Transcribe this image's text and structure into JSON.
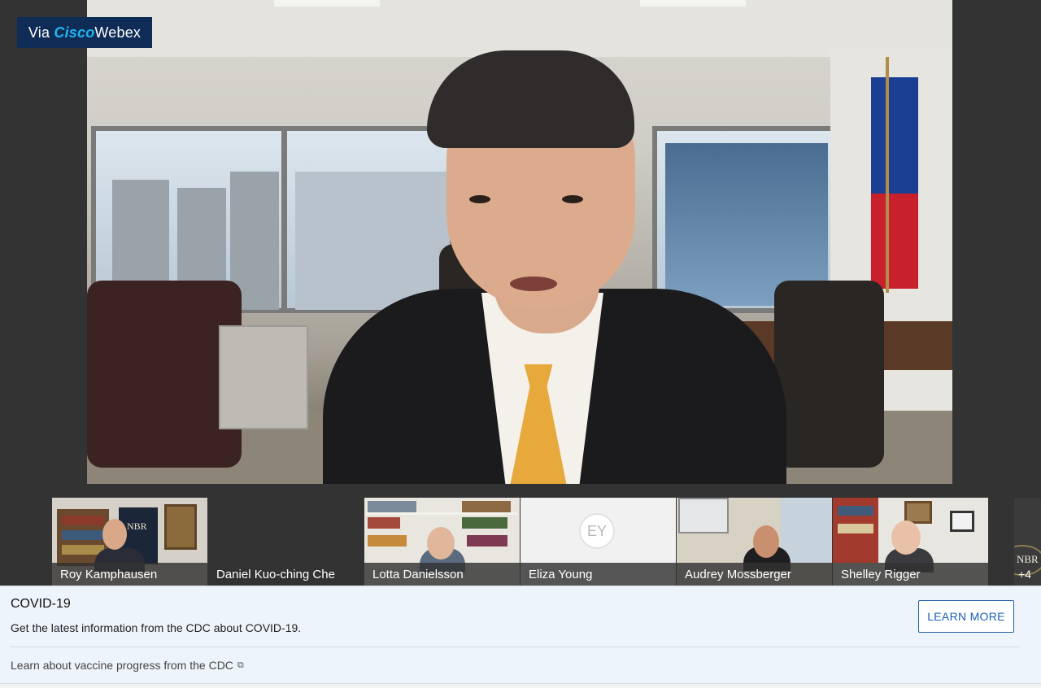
{
  "webex_badge": {
    "prefix": "Via ",
    "brand_a": "Cisco",
    "brand_b": "Webex"
  },
  "participants": [
    {
      "name": "Roy Kamphausen"
    },
    {
      "name": "Daniel Kuo-ching Che"
    },
    {
      "name": "Lotta Danielsson"
    },
    {
      "name": "Eliza Young",
      "initials": "EY"
    },
    {
      "name": "Audrey Mossberger"
    },
    {
      "name": "Shelley Rigger"
    }
  ],
  "nbr_logo_text": "NBR",
  "overflow_count": "+4",
  "covid_panel": {
    "title": "COVID-19",
    "description": "Get the latest information from the CDC about COVID-19.",
    "button_label": "LEARN MORE",
    "vaccine_link": "Learn about vaccine progress from the CDC",
    "external_link_icon": "external-link-icon"
  },
  "colors": {
    "badge_bg": "#0f2c57",
    "badge_accent": "#20b6f0",
    "panel_bg": "#eef4fb",
    "button_border": "#1f5fa8"
  }
}
